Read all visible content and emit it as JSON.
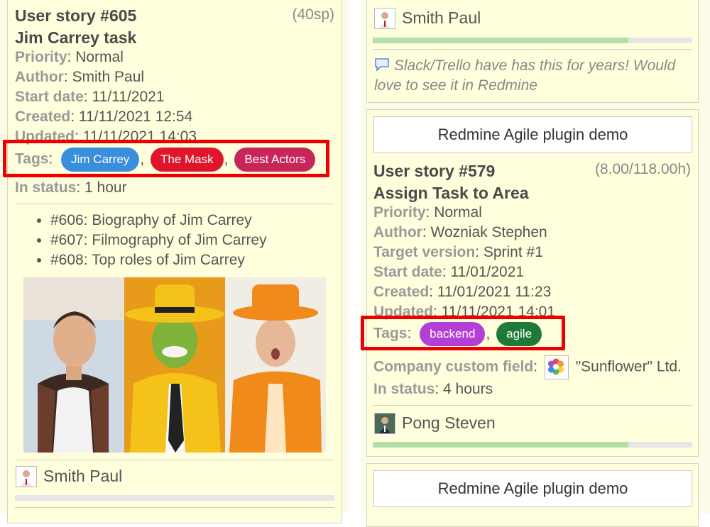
{
  "left_card": {
    "title": "User story #605",
    "estimate": "(40sp)",
    "subject": "Jim Carrey task",
    "fields": [
      {
        "label": "Priority",
        "value": "Normal"
      },
      {
        "label": "Author",
        "value": "Smith Paul"
      },
      {
        "label": "Start date",
        "value": "11/11/2021"
      },
      {
        "label": "Created",
        "value": "11/11/2021 12:54"
      },
      {
        "label": "Updated",
        "value": "11/11/2021 14:03"
      }
    ],
    "tags_label": "Tags",
    "tags": [
      {
        "name": "Jim Carrey",
        "color": "#3a8ede"
      },
      {
        "name": "The Mask",
        "color": "#e0142a"
      },
      {
        "name": "Best Actors",
        "color": "#c8265a"
      }
    ],
    "status_label": "In status",
    "status_value": "1 hour",
    "subtasks": [
      "#606: Biography of Jim Carrey",
      "#607: Filmography of Jim Carrey",
      "#608: Top roles of Jim Carrey"
    ],
    "assignee": "Smith Paul"
  },
  "right_card_top": {
    "assignee": "Smith Paul",
    "progress_percent": 80,
    "comment": "Slack/Trello have has this for years! Would love to see it in Redmine"
  },
  "right_card_main": {
    "project_button": "Redmine Agile plugin demo",
    "title": "User story #579",
    "estimate": "(8.00/118.00h)",
    "subject": "Assign Task to Area",
    "fields": [
      {
        "label": "Priority",
        "value": "Normal"
      },
      {
        "label": "Author",
        "value": "Wozniak Stephen"
      },
      {
        "label": "Target version",
        "value": "Sprint #1"
      },
      {
        "label": "Start date",
        "value": "11/01/2021"
      },
      {
        "label": "Created",
        "value": "11/01/2021 11:23"
      },
      {
        "label": "Updated",
        "value": "11/11/2021 14:01"
      }
    ],
    "tags_label": "Tags",
    "tags": [
      {
        "name": "backend",
        "color": "#b53fd6"
      },
      {
        "name": "agile",
        "color": "#1f7a3a"
      }
    ],
    "company_label": "Company custom field",
    "company_value": "\"Sunflower\" Ltd.",
    "status_label": "In status",
    "status_value": "4 hours",
    "assignee": "Pong Steven",
    "progress_percent": 80
  },
  "right_card_bottom": {
    "project_button": "Redmine Agile plugin demo"
  }
}
